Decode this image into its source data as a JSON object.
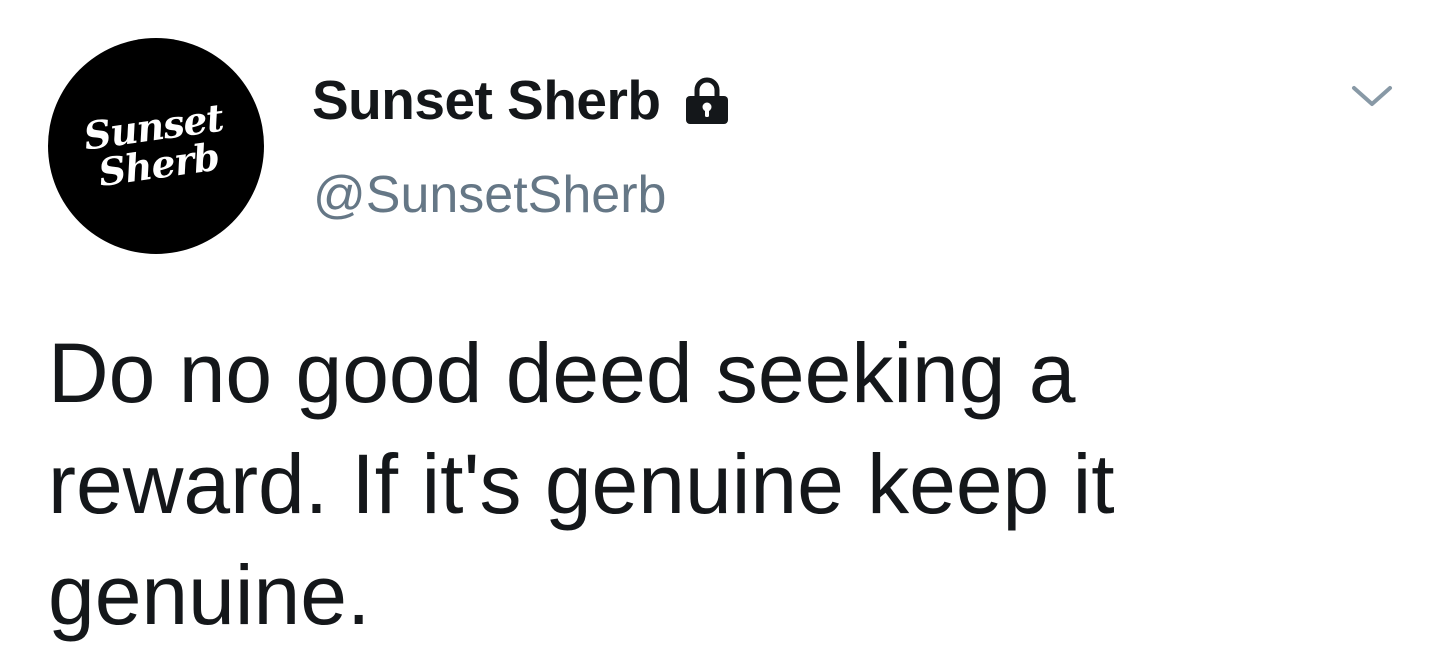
{
  "tweet": {
    "author": {
      "display_name": "Sunset Sherb",
      "handle": "@SunsetSherb",
      "avatar_logo_line1": "Sunset",
      "avatar_logo_line2": "Sherb",
      "protected": true
    },
    "text": "Do no good deed seeking a\nreward. If it's genuine keep it\ngenuine.",
    "icons": {
      "lock": "lock-icon",
      "menu": "chevron-down-icon"
    },
    "colors": {
      "text": "#14171a",
      "secondary_text": "#657786",
      "avatar_background": "#000000",
      "chevron": "#8899a6"
    }
  }
}
